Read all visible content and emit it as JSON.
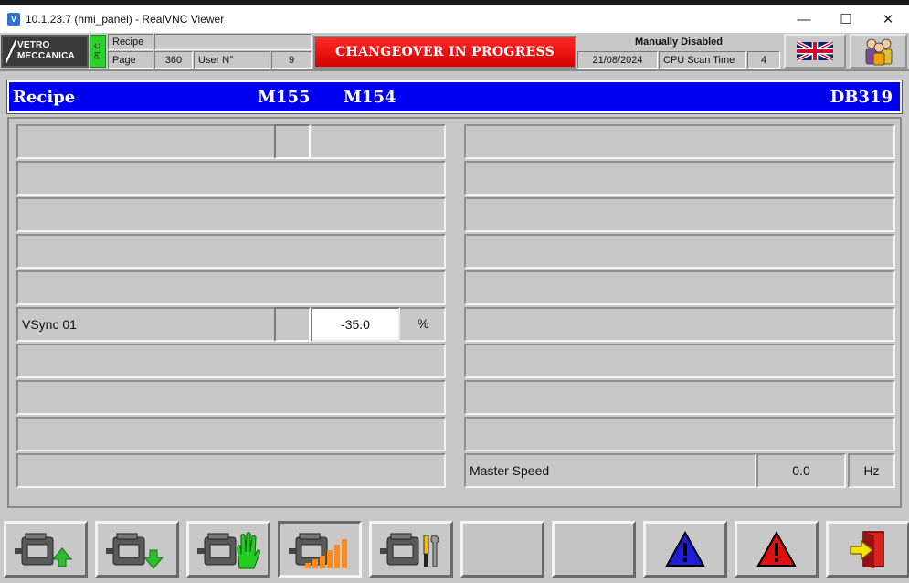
{
  "window": {
    "title": "10.1.23.7 (hmi_panel) - RealVNC Viewer",
    "app_icon": "vnc-icon",
    "minimize": "—",
    "maximize": "☐",
    "close": "✕"
  },
  "header": {
    "logo_line1": "VETRO",
    "logo_line2": "MECCANICA",
    "plc_label": "PLC",
    "recipe_label": "Recipe",
    "recipe_value": "",
    "page_label": "Page",
    "page_value": "360",
    "user_label": "User N°",
    "user_value": "9",
    "status_banner": "CHANGEOVER IN PROGRESS",
    "mode_text": "Manually Disabled",
    "date": "21/08/2024",
    "cpu_label": "CPU Scan Time",
    "cpu_value": "4",
    "language_icon": "uk-flag-icon",
    "users_icon": "users-icon"
  },
  "band": {
    "title": "Recipe",
    "code1": "M155",
    "code2": "M154",
    "db": "DB319"
  },
  "left_rows": [
    {
      "label": ""
    },
    {
      "label": ""
    },
    {
      "label": ""
    },
    {
      "label": ""
    },
    {
      "label": ""
    },
    {
      "label": "VSync 01",
      "value": "-35.0",
      "unit": "%"
    },
    {
      "label": ""
    },
    {
      "label": ""
    },
    {
      "label": ""
    },
    {
      "label": ""
    }
  ],
  "right_rows": [
    {
      "label": ""
    },
    {
      "label": ""
    },
    {
      "label": ""
    },
    {
      "label": ""
    },
    {
      "label": ""
    },
    {
      "label": ""
    },
    {
      "label": ""
    },
    {
      "label": ""
    },
    {
      "label": ""
    },
    {
      "label": "Master Speed",
      "value": "0.0",
      "unit": "Hz"
    }
  ],
  "toolbar": {
    "buttons": [
      {
        "icon": "motor-up-arrow-icon"
      },
      {
        "icon": "motor-down-arrow-icon"
      },
      {
        "icon": "motor-manual-hand-icon"
      },
      {
        "icon": "motor-speed-ramp-icon"
      },
      {
        "icon": "motor-maintenance-tools-icon"
      },
      {
        "icon": ""
      },
      {
        "icon": ""
      },
      {
        "icon": "blue-warning-icon"
      },
      {
        "icon": "red-alarm-icon"
      },
      {
        "icon": "exit-door-icon"
      }
    ]
  },
  "colors": {
    "band_blue": "#0000f0",
    "banner_red": "#e00000",
    "plc_green": "#2ecf2e",
    "panel_gray": "#c8c8c8"
  }
}
